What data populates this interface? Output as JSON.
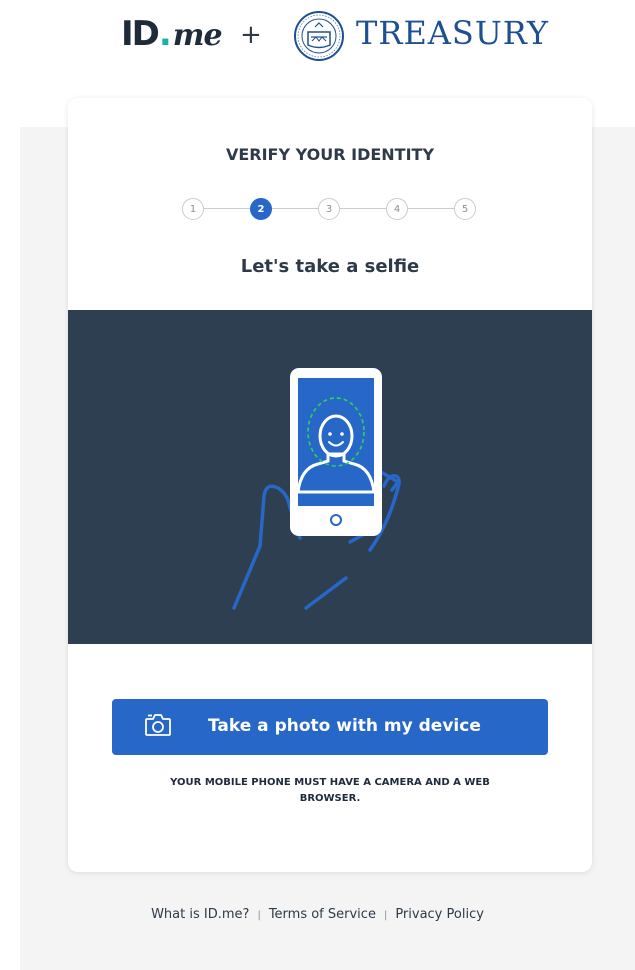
{
  "header": {
    "idme_id": "ID",
    "idme_dot": ".",
    "idme_me": "me",
    "plus": "+",
    "treasury": "TREASURY"
  },
  "card": {
    "title": "VERIFY YOUR IDENTITY",
    "steps": [
      "1",
      "2",
      "3",
      "4",
      "5"
    ],
    "current_step": 2,
    "subtitle": "Let's take a selfie",
    "button_label": "Take a photo with my device",
    "notice": "YOUR MOBILE PHONE MUST HAVE A CAMERA AND A WEB BROWSER."
  },
  "footer": {
    "links": [
      "What is ID.me?",
      "Terms of Service",
      "Privacy Policy"
    ],
    "separator": "|"
  },
  "colors": {
    "primary": "#2767c7",
    "illustration_bg": "#2e3f52",
    "face_guide": "#2fd15a",
    "treasury_blue": "#1d4f91",
    "idme_teal": "#16b3a8"
  },
  "icons": {
    "camera": "camera-icon",
    "seal": "treasury-seal-icon",
    "selfie": "phone-selfie-illustration"
  }
}
